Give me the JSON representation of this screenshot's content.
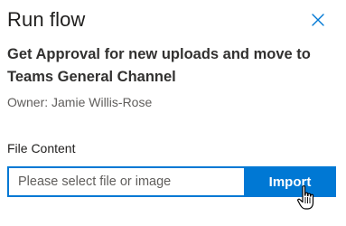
{
  "panel": {
    "title": "Run flow",
    "close_icon": "close-icon",
    "flow_name": "Get Approval for new uploads and move to Teams General Channel",
    "owner": "Owner: Jamie Willis-Rose"
  },
  "file_content": {
    "label": "File Content",
    "placeholder": "Please select file or image",
    "value": "",
    "import_label": "Import"
  },
  "colors": {
    "accent": "#0078d4",
    "text": "#201f1e",
    "secondary_text": "#605e5c"
  },
  "cursor_icon": "hand-pointer-icon"
}
